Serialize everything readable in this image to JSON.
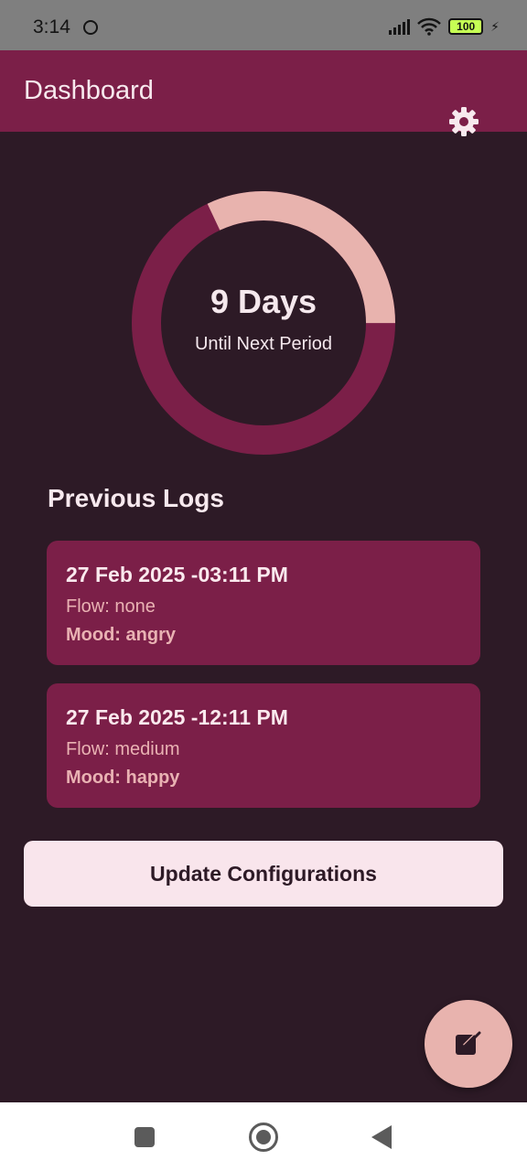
{
  "status_bar": {
    "time": "3:14",
    "battery": "100"
  },
  "app_bar": {
    "title": "Dashboard",
    "settings_icon": "gear-icon"
  },
  "cycle": {
    "days_label": "9 Days",
    "caption": "Until Next Period",
    "remaining_fraction": 0.32,
    "colors": {
      "track": "#7b1f48",
      "remaining": "#e8b3ae"
    }
  },
  "logs": {
    "title": "Previous Logs",
    "items": [
      {
        "date": "27 Feb 2025 -03:11 PM",
        "flow": "Flow: none",
        "mood": "Mood: angry"
      },
      {
        "date": "27 Feb 2025 -12:11 PM",
        "flow": "Flow: medium",
        "mood": "Mood: happy"
      }
    ]
  },
  "actions": {
    "update_label": "Update Configurations",
    "fab_icon": "edit-icon"
  },
  "colors": {
    "background": "#2d1a26",
    "primary": "#7b1f48",
    "accent": "#e8b3ae"
  }
}
